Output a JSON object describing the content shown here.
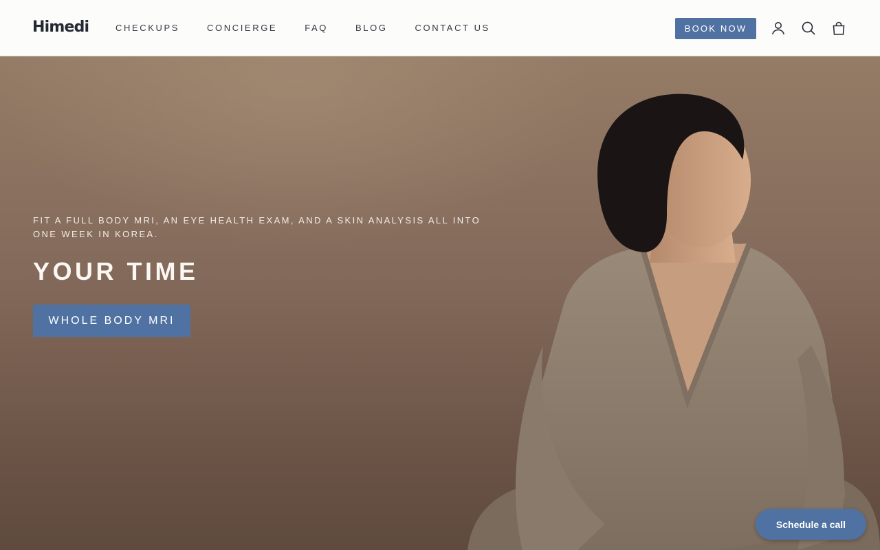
{
  "header": {
    "logo": "Himedi",
    "nav": [
      {
        "label": "CHECKUPS"
      },
      {
        "label": "CONCIERGE"
      },
      {
        "label": "FAQ"
      },
      {
        "label": "BLOG"
      },
      {
        "label": "CONTACT US"
      }
    ],
    "book_label": "BOOK NOW",
    "icons": [
      "account-icon",
      "search-icon",
      "cart-icon"
    ]
  },
  "hero": {
    "eyebrow": "FIT A FULL BODY MRI, AN EYE HEALTH EXAM, AND A SKIN ANALYSIS ALL INTO ONE WEEK IN KOREA.",
    "title": "YOUR TIME",
    "cta_label": "WHOLE BODY MRI"
  },
  "widget": {
    "schedule_label": "Schedule a call"
  },
  "colors": {
    "accent": "#4f72a2",
    "header_bg": "#fcfcfa",
    "hero_bg": "#7d6552"
  }
}
